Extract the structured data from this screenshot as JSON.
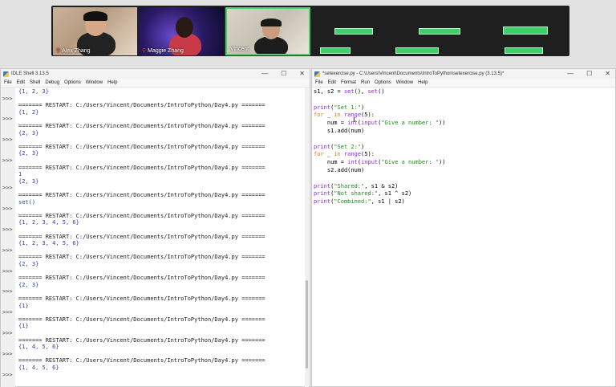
{
  "video": {
    "participants": [
      {
        "name": "Alex Zhang"
      },
      {
        "name": "Maggie Zhang"
      },
      {
        "name": "Vincent"
      }
    ]
  },
  "shell": {
    "title": "IDLE Shell 3.13.5",
    "menu": [
      "File",
      "Edit",
      "Shell",
      "Debug",
      "Options",
      "Window",
      "Help"
    ],
    "lines": [
      {
        "type": "out",
        "text": "{1, 2, 3}"
      },
      {
        "type": "prompt",
        "text": ">>>"
      },
      {
        "type": "restart",
        "text": "======= RESTART: C:/Users/Vincent/Documents/IntroToPython/Day4.py ======="
      },
      {
        "type": "out",
        "text": "{1, 2}"
      },
      {
        "type": "prompt",
        "text": ">>>"
      },
      {
        "type": "restart",
        "text": "======= RESTART: C:/Users/Vincent/Documents/IntroToPython/Day4.py ======="
      },
      {
        "type": "out",
        "text": "{2, 3}"
      },
      {
        "type": "prompt",
        "text": ">>>"
      },
      {
        "type": "restart",
        "text": "======= RESTART: C:/Users/Vincent/Documents/IntroToPython/Day4.py ======="
      },
      {
        "type": "out",
        "text": "{2, 3}"
      },
      {
        "type": "prompt",
        "text": ">>>"
      },
      {
        "type": "restart",
        "text": "======= RESTART: C:/Users/Vincent/Documents/IntroToPython/Day4.py ======="
      },
      {
        "type": "out",
        "text": "1"
      },
      {
        "type": "out",
        "text": "{2, 3}"
      },
      {
        "type": "prompt",
        "text": ">>>"
      },
      {
        "type": "restart",
        "text": "======= RESTART: C:/Users/Vincent/Documents/IntroToPython/Day4.py ======="
      },
      {
        "type": "out",
        "text": "set()"
      },
      {
        "type": "prompt",
        "text": ">>>"
      },
      {
        "type": "restart",
        "text": "======= RESTART: C:/Users/Vincent/Documents/IntroToPython/Day4.py ======="
      },
      {
        "type": "out",
        "text": "{1, 2, 3, 4, 5, 6}"
      },
      {
        "type": "prompt",
        "text": ">>>"
      },
      {
        "type": "restart",
        "text": "======= RESTART: C:/Users/Vincent/Documents/IntroToPython/Day4.py ======="
      },
      {
        "type": "out",
        "text": "{1, 2, 3, 4, 5, 6}"
      },
      {
        "type": "prompt",
        "text": ">>>"
      },
      {
        "type": "restart",
        "text": "======= RESTART: C:/Users/Vincent/Documents/IntroToPython/Day4.py ======="
      },
      {
        "type": "out",
        "text": "{2, 3}"
      },
      {
        "type": "prompt",
        "text": ">>>"
      },
      {
        "type": "restart",
        "text": "======= RESTART: C:/Users/Vincent/Documents/IntroToPython/Day4.py ======="
      },
      {
        "type": "out",
        "text": "{2, 3}"
      },
      {
        "type": "prompt",
        "text": ">>>"
      },
      {
        "type": "restart",
        "text": "======= RESTART: C:/Users/Vincent/Documents/IntroToPython/Day4.py ======="
      },
      {
        "type": "out",
        "text": "{1}"
      },
      {
        "type": "prompt",
        "text": ">>>"
      },
      {
        "type": "restart",
        "text": "======= RESTART: C:/Users/Vincent/Documents/IntroToPython/Day4.py ======="
      },
      {
        "type": "out",
        "text": "{1}"
      },
      {
        "type": "prompt",
        "text": ">>>"
      },
      {
        "type": "restart",
        "text": "======= RESTART: C:/Users/Vincent/Documents/IntroToPython/Day4.py ======="
      },
      {
        "type": "out",
        "text": "{1, 4, 5, 6}"
      },
      {
        "type": "prompt",
        "text": ">>>"
      },
      {
        "type": "restart",
        "text": "======= RESTART: C:/Users/Vincent/Documents/IntroToPython/Day4.py ======="
      },
      {
        "type": "out",
        "text": "{1, 4, 5, 6}"
      },
      {
        "type": "prompt",
        "text": ">>>"
      }
    ]
  },
  "editor": {
    "title": "*setexercise.py - C:\\Users\\Vincent\\Documents\\IntroToPython\\setexercise.py (3.13.5)*",
    "menu": [
      "File",
      "Edit",
      "Format",
      "Run",
      "Options",
      "Window",
      "Help"
    ],
    "code": [
      "s1, s2 = set(), set()",
      "",
      "print(\"Set 1:\")",
      "for _ in range(5):",
      "    num = int(input(\"Give a number: \"))",
      "    s1.add(num)",
      "",
      "print(\"Set 2:\")",
      "for _ in range(5):",
      "    num = int(input(\"Give a number: \"))",
      "    s2.add(num)",
      "",
      "print(\"Shared:\", s1 & s2)",
      "print(\"Not shared:\", s1 ^ s2)",
      "print(\"Combined:\", s1 | s2)"
    ]
  },
  "window_controls": {
    "minimize": "—",
    "maximize": "☐",
    "close": "✕"
  },
  "colors": {
    "keyword": "#e07a10",
    "builtin": "#8a2be2",
    "string": "#1a8a1a",
    "shell_output": "#2f3fb0",
    "active_speaker": "#44d46a"
  }
}
